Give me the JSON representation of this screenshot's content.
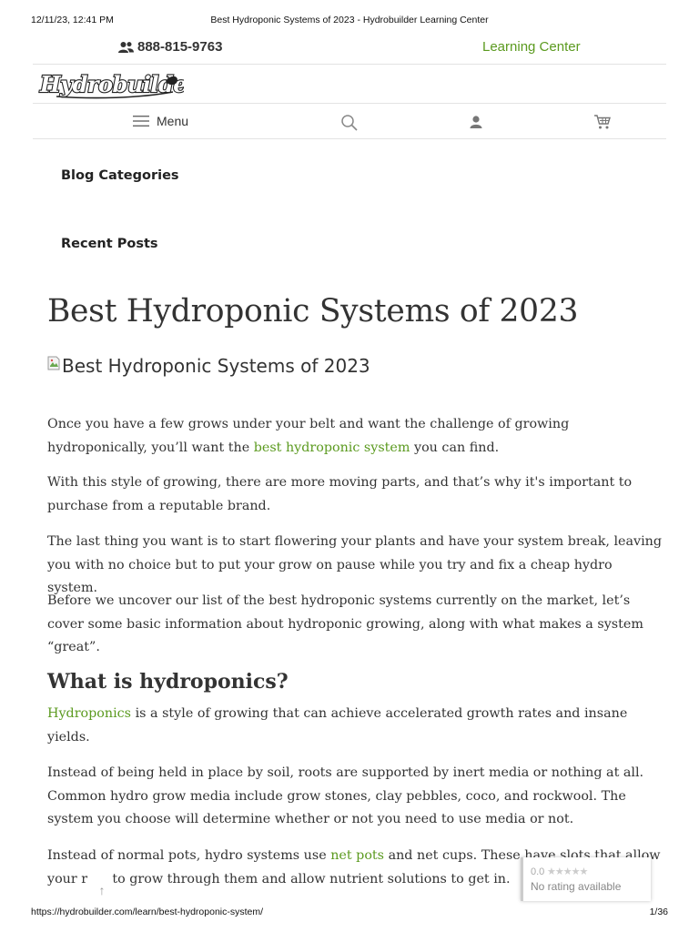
{
  "print_header": {
    "datetime": "12/11/23, 12:41 PM",
    "doc_title": "Best Hydroponic Systems of 2023 - Hydrobuilder Learning Center"
  },
  "topbar": {
    "phone": "888-815-9763",
    "learning_center": "Learning Center"
  },
  "logo": {
    "text": "Hydrobuilder"
  },
  "nav": {
    "menu_label": "Menu"
  },
  "sidebar": {
    "blog_categories": "Blog Categories",
    "recent_posts": "Recent Posts"
  },
  "article": {
    "title": "Best Hydroponic Systems of 2023",
    "image_alt": "Best Hydroponic Systems of 2023",
    "p1_before": "Once you have a few grows under your belt and want the challenge of growing hydroponically, you’ll want the ",
    "p1_link": "best hydroponic system",
    "p1_after": " you can find.",
    "p2": "With this style of growing, there are more moving parts, and that’s why it's important to purchase from a reputable brand.",
    "p3": "The last thing you want is to start flowering your plants and have your system break, leaving you with no choice but to put your grow on pause while you try and fix a cheap hydro system.",
    "p4": "Before we uncover our list of the best hydroponic systems currently on the market, let’s cover some basic information about hydroponic growing, along with what makes a system “great”.",
    "h2": "What is hydroponics?",
    "p5_link": "Hydroponics",
    "p5_after": " is a style of growing that can achieve accelerated growth rates and insane yields.",
    "p6": "Instead of being held in place by soil, roots are supported by inert media or nothing at all. Common hydro grow media include grow stones, clay pebbles, coco, and rockwool. The system you choose will determine whether or not you need to use media or not.",
    "p7_before": "Instead of normal pots, hydro systems use ",
    "p7_link": "net pots",
    "p7_mid": " and net cups. These have slots that allow",
    "p7_line2": "your r      to grow through them and allow nutrient solutions to get in."
  },
  "rating_widget": {
    "score": "0.0",
    "stars": "★★★★★",
    "text": "No rating available"
  },
  "scroll_arrow": "↑",
  "print_footer": {
    "url": "https://hydrobuilder.com/learn/best-hydroponic-system/",
    "page": "1/36"
  },
  "colors": {
    "accent_green": "#5b9a1f",
    "text": "#333333",
    "divider": "#e3e3e3"
  }
}
